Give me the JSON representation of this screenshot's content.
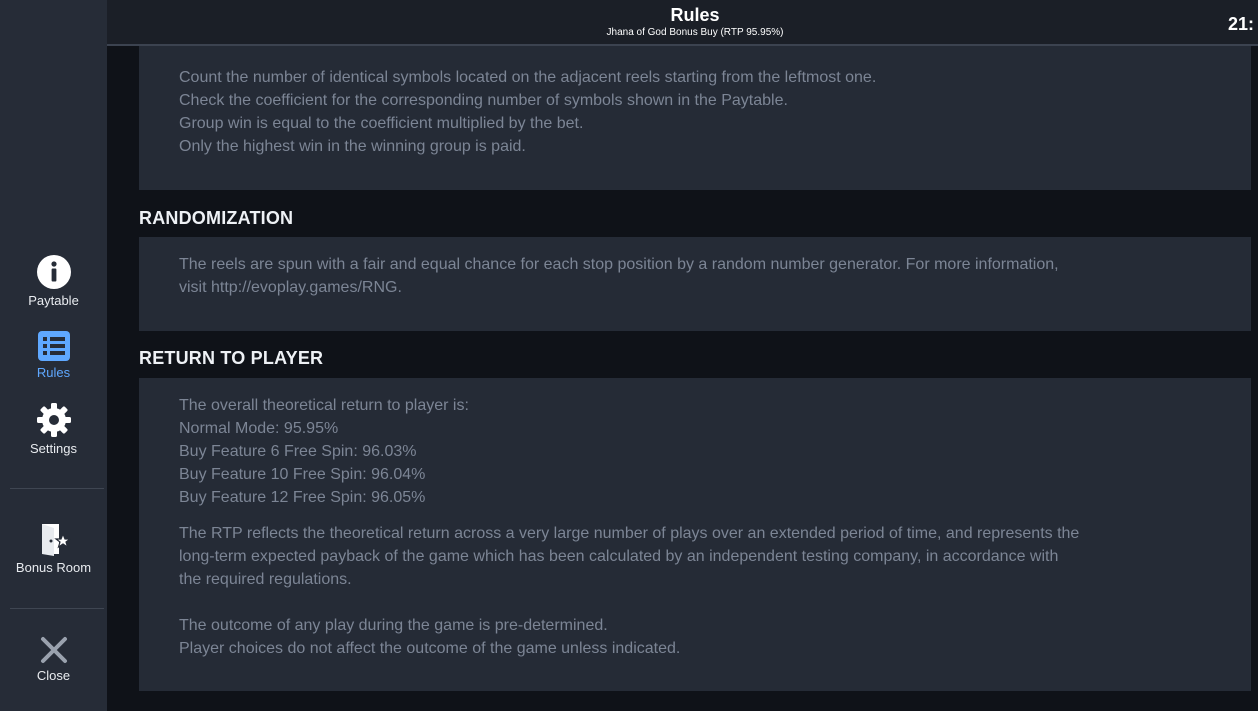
{
  "sidebar": {
    "items": [
      {
        "label": "Paytable",
        "icon": "info-icon"
      },
      {
        "label": "Rules",
        "icon": "list-icon",
        "active": true
      },
      {
        "label": "Settings",
        "icon": "gear-icon"
      },
      {
        "label": "Bonus Room",
        "icon": "door-star-icon"
      },
      {
        "label": "Close",
        "icon": "close-icon"
      }
    ],
    "active_color": "#5fa8ff"
  },
  "header": {
    "title": "Rules",
    "subtitle": "Jhana of God Bonus Buy (RTP 95.95%)",
    "clock": "21:"
  },
  "sections": {
    "group_win": {
      "lines": [
        "Count the number of identical symbols located on the adjacent reels starting from the leftmost one.",
        "Check the coefficient for the corresponding number of symbols shown in the Paytable.",
        "Group win is equal to the coefficient multiplied by the bet.",
        "Only the highest win in the winning group is paid."
      ]
    },
    "randomization": {
      "title": "RANDOMIZATION",
      "lines": [
        "The reels are spun with a fair and equal chance for each stop position by a random number generator. For more information,",
        "visit http://evoplay.games/RNG."
      ]
    },
    "rtp": {
      "title": "RETURN TO PLAYER",
      "lines": [
        "The overall theoretical return to player is:",
        "Normal Mode: 95.95%",
        "Buy Feature 6 Free Spin: 96.03%",
        "Buy Feature 10 Free Spin: 96.04%",
        "Buy Feature 12 Free Spin: 96.05%"
      ],
      "description": [
        "The RTP reflects the theoretical return across a very large number of plays over an extended period of time, and represents the",
        "long-term expected payback of the game which has been calculated by an independent testing company, in accordance with",
        "the required regulations."
      ],
      "outcome": [
        "The outcome of any play during the game is pre-determined.",
        "Player choices do not affect the outcome of the game unless indicated."
      ]
    }
  }
}
